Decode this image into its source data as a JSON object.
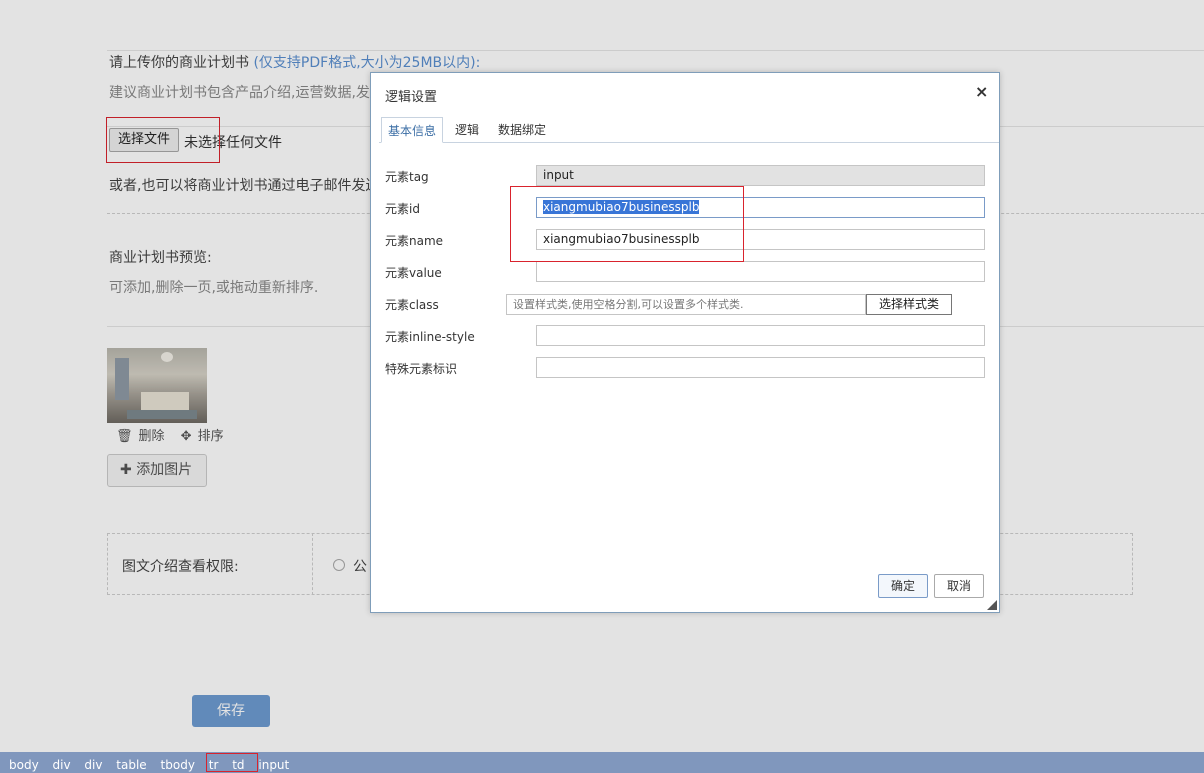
{
  "form": {
    "upload_title": "请上传你的商业计划书",
    "upload_hint": "(仅支持PDF格式,大小为25MB以内):",
    "upload_desc": "建议商业计划书包含产品介绍,运营数据,发",
    "file_button": "选择文件",
    "file_status": "未选择任何文件",
    "email_text": "或者,也可以将商业计划书通过电子邮件发送",
    "preview_title": "商业计划书预览:",
    "preview_desc": "可添加,删除一页,或拖动重新排序.",
    "delete_label": "删除",
    "sort_label": "排序",
    "add_image_label": "添加图片",
    "permission_label": "图文介绍查看权限:",
    "permission_option": "公",
    "save_label": "保存"
  },
  "breadcrumbs": [
    "body",
    "div",
    "div",
    "table",
    "tbody",
    "tr",
    "td",
    "input"
  ],
  "dialog": {
    "title": "逻辑设置",
    "close": "×",
    "tabs": [
      "基本信息",
      "逻辑",
      "数据绑定"
    ],
    "fields": {
      "tag_label": "元素tag",
      "tag_value": "input",
      "id_label": "元素id",
      "id_value": "xiangmubiao7businessplb",
      "name_label": "元素name",
      "name_value": "xiangmubiao7businessplb",
      "value_label": "元素value",
      "value_value": "",
      "class_label": "元素class",
      "class_placeholder": "设置样式类,使用空格分割,可以设置多个样式类.",
      "class_button": "选择样式类",
      "style_label": "元素inline-style",
      "style_value": "",
      "special_label": "特殊元素标识",
      "special_value": ""
    },
    "confirm": "确定",
    "cancel": "取消"
  },
  "colors": {
    "accent": "#5a8fd0",
    "save_button": "#6d9bd1",
    "statusbar": "#8097bd",
    "highlight_box": "#d9232d",
    "selection": "#3875d7"
  }
}
